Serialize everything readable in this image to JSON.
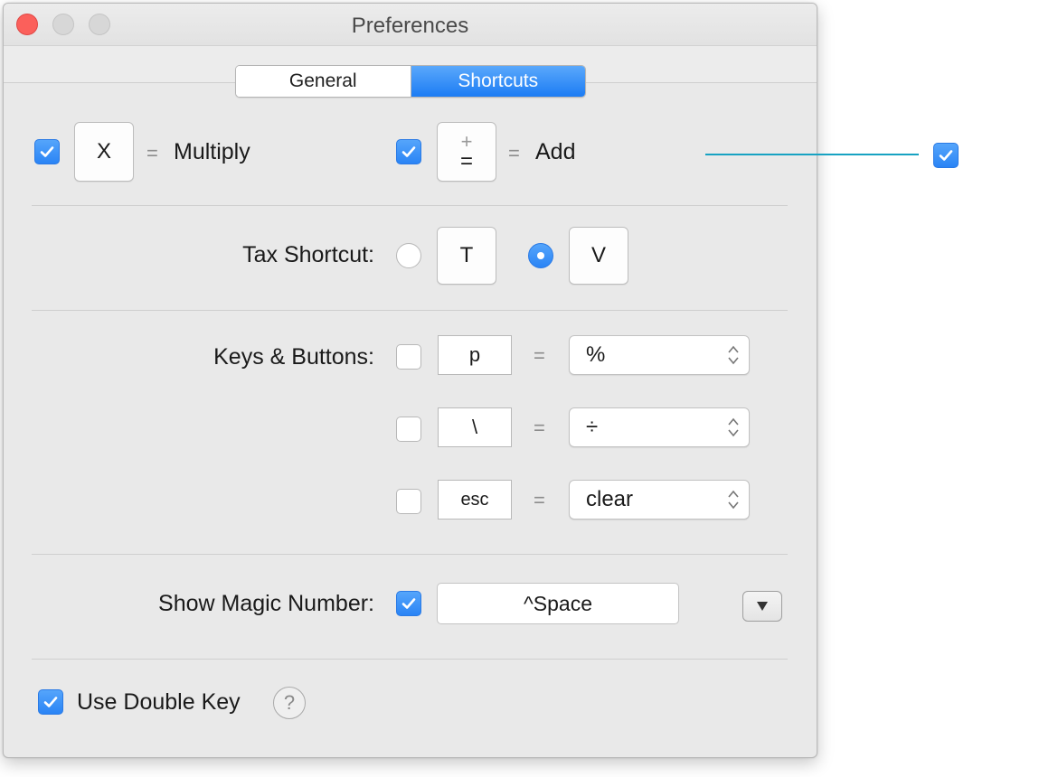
{
  "window": {
    "title": "Preferences"
  },
  "tabs": [
    {
      "label": "General",
      "selected": false
    },
    {
      "label": "Shortcuts",
      "selected": true
    }
  ],
  "operators": {
    "multiply": {
      "checked": true,
      "key": "X",
      "equals": "=",
      "label": "Multiply"
    },
    "add": {
      "checked": true,
      "key_top": "+",
      "key_bottom": "=",
      "equals": "=",
      "label": "Add"
    }
  },
  "tax_shortcut": {
    "label": "Tax Shortcut:",
    "options": [
      {
        "key": "T",
        "selected": false
      },
      {
        "key": "V",
        "selected": true
      }
    ]
  },
  "keys_buttons": {
    "label": "Keys & Buttons:",
    "rows": [
      {
        "checked": false,
        "key": "p",
        "equals": "=",
        "value": "%"
      },
      {
        "checked": false,
        "key": "\\",
        "equals": "=",
        "value": "÷"
      },
      {
        "checked": false,
        "key": "esc",
        "equals": "=",
        "value": "clear"
      }
    ]
  },
  "magic_number": {
    "label": "Show Magic Number:",
    "checked": true,
    "shortcut": "^Space",
    "menu_icon": "triangle-down-icon"
  },
  "double_key": {
    "checked": true,
    "label": "Use Double Key",
    "help": "?"
  },
  "callout": {
    "checked": true
  },
  "colors": {
    "accent": "#2a84f5",
    "callout_line": "#17a2c2",
    "close_button": "#fb605b"
  }
}
